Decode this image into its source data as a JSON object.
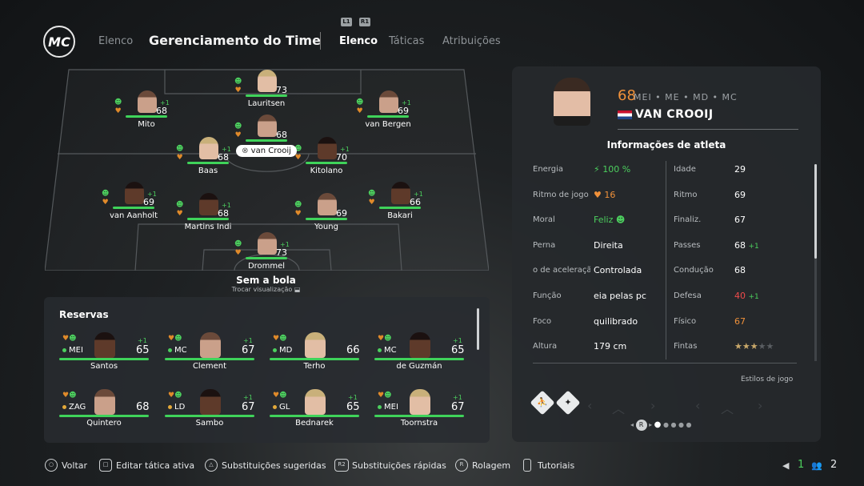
{
  "header": {
    "logo": "MC",
    "nav_back": "Elenco",
    "title": "Gerenciamento do Time",
    "shoulder_left": "L1",
    "shoulder_right": "R1",
    "tabs": [
      "Elenco",
      "Táticas",
      "Atribuições"
    ]
  },
  "pitch": {
    "players": [
      {
        "name": "Lauritsen",
        "ovr": "73"
      },
      {
        "name": "Mito",
        "ovr": "68",
        "plus": "+1"
      },
      {
        "name": "van Bergen",
        "ovr": "69",
        "plus": "+1"
      },
      {
        "name": "van Crooij",
        "ovr": "68"
      },
      {
        "name": "Baas",
        "ovr": "68",
        "plus": "+1"
      },
      {
        "name": "Kitolano",
        "ovr": "70",
        "plus": "+1"
      },
      {
        "name": "van Aanholt",
        "ovr": "69",
        "plus": "+1"
      },
      {
        "name": "Martins Indi",
        "ovr": "68",
        "plus": "+1"
      },
      {
        "name": "Young",
        "ovr": "69"
      },
      {
        "name": "Bakari",
        "ovr": "66",
        "plus": "+1"
      },
      {
        "name": "Drommel",
        "ovr": "73",
        "plus": "+1"
      }
    ],
    "selected_chip": "van Crooij",
    "mode": "Sem a bola",
    "toggle_hint": "Trocar visualização"
  },
  "reserves": {
    "title": "Reservas",
    "cards": [
      {
        "pos": "MEI",
        "ovr": "65",
        "plus": "+1",
        "name": "Santos"
      },
      {
        "pos": "MC",
        "ovr": "67",
        "plus": "+1",
        "name": "Clement"
      },
      {
        "pos": "MD",
        "ovr": "66",
        "name": "Terho"
      },
      {
        "pos": "MC",
        "ovr": "65",
        "plus": "+1",
        "name": "de Guzmán"
      },
      {
        "pos": "ZAG",
        "ovr": "68",
        "name": "Quintero"
      },
      {
        "pos": "LD",
        "ovr": "67",
        "plus": "+1",
        "name": "Sambo"
      },
      {
        "pos": "GL",
        "ovr": "65",
        "plus": "+1",
        "name": "Bednarek"
      },
      {
        "pos": "MEI",
        "ovr": "67",
        "plus": "+1",
        "name": "Toornstra"
      }
    ]
  },
  "athlete": {
    "ovr": "68",
    "positions": "MEI • ME • MD • MC",
    "name": "VAN CROOIJ",
    "info_title": "Informações de atleta",
    "left": [
      {
        "label": "Energia",
        "value": "100 %"
      },
      {
        "label": "Ritmo de jogo",
        "value": "16"
      },
      {
        "label": "Moral",
        "value": "Feliz"
      },
      {
        "label": "Perna",
        "value": "Direita"
      },
      {
        "label": "o de aceleraçã",
        "value": "Controlada"
      },
      {
        "label": "Função",
        "value": "eia pelas pc"
      },
      {
        "label": "Foco",
        "value": "quilibrado"
      },
      {
        "label": "Altura",
        "value": "179 cm"
      }
    ],
    "right": [
      {
        "label": "Idade",
        "value": "29"
      },
      {
        "label": "Ritmo",
        "value": "69"
      },
      {
        "label": "Finaliz.",
        "value": "67"
      },
      {
        "label": "Passes",
        "value": "68",
        "plus": "+1"
      },
      {
        "label": "Condução",
        "value": "68"
      },
      {
        "label": "Defesa",
        "value": "40",
        "plus": "+1"
      },
      {
        "label": "Físico",
        "value": "67"
      },
      {
        "label": "Fintas",
        "value": "★★★★★",
        "stars": 3
      }
    ],
    "playstyles_label": "Estilos de jogo",
    "page_label": "R"
  },
  "footer": {
    "items": [
      "Voltar",
      "Editar tática ativa",
      "Substituições sugeridas",
      "Substituições rápidas",
      "Rolagem",
      "Tutoriais"
    ],
    "btn_r2": "R2",
    "btn_r": "R",
    "count_a": "1",
    "count_b": "2"
  },
  "colors": {
    "accent_green": "#3fd35a",
    "accent_orange": "#f0913a",
    "danger_red": "#ef4b4b"
  }
}
